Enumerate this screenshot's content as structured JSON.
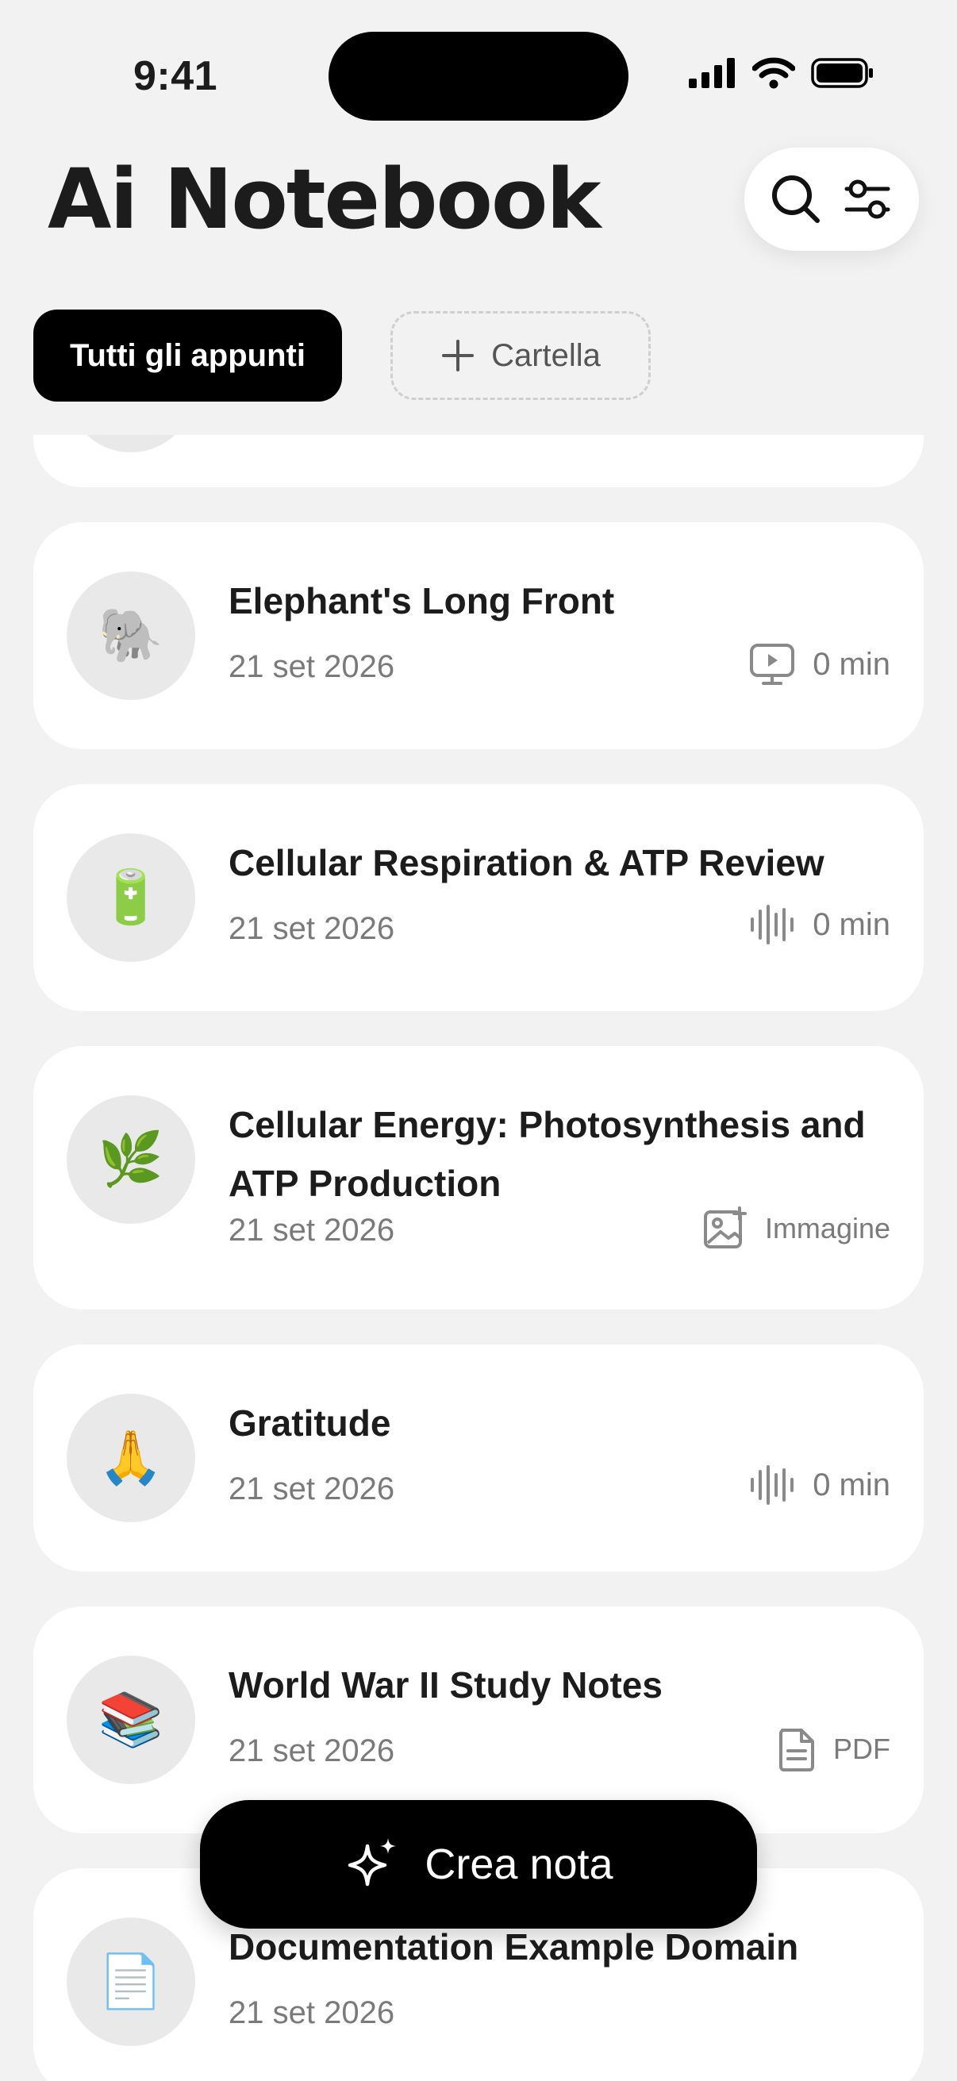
{
  "status_bar": {
    "time": "9:41"
  },
  "header": {
    "title": "Ai Notebook",
    "search_icon": "search-icon",
    "filter_icon": "sliders-icon"
  },
  "folders": {
    "all_label": "Tutti gli appunti",
    "add_label": "Cartella"
  },
  "notes": [
    {
      "emoji": "🐘",
      "title": "Elephant's Long Front",
      "date": "21 set 2026",
      "meta_icon": "video-icon",
      "meta": "0 min"
    },
    {
      "emoji": "🔋",
      "title": "Cellular Respiration & ATP Review",
      "date": "21 set 2026",
      "meta_icon": "waveform-icon",
      "meta": "0 min"
    },
    {
      "emoji": "🌿",
      "title": "Cellular Energy: Photosynthesis and ATP Production",
      "date": "21 set 2026",
      "meta_icon": "image-icon",
      "meta": "Immagine"
    },
    {
      "emoji": "🙏",
      "title": "Gratitude",
      "date": "21 set 2026",
      "meta_icon": "waveform-icon",
      "meta": "0 min"
    },
    {
      "emoji": "📚",
      "title": "World War II Study Notes",
      "date": "21 set 2026",
      "meta_icon": "document-icon",
      "meta": "PDF"
    },
    {
      "emoji": "📄",
      "title": "Documentation Example Domain",
      "date": "21 set 2026"
    }
  ],
  "fab": {
    "label": "Crea nota",
    "icon": "sparkles-icon"
  },
  "colors": {
    "background": "#f2f2f2",
    "card": "#ffffff",
    "accent": "#000000",
    "muted": "#7a7a7a"
  }
}
